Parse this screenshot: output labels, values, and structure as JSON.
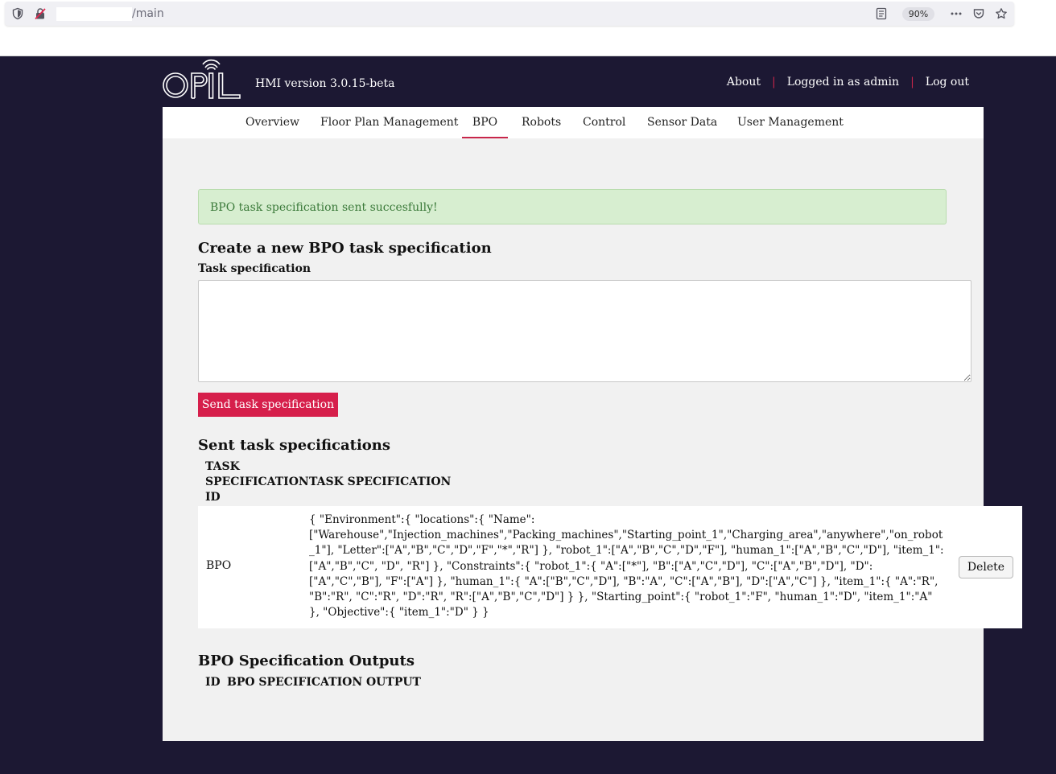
{
  "browser": {
    "url_path": "/main",
    "zoom": "90%"
  },
  "header": {
    "hmi_version": "HMI version 3.0.15-beta",
    "links": {
      "about": "About",
      "logged_in": "Logged in as admin",
      "logout": "Log out"
    },
    "accent_color": "#c8264a"
  },
  "nav": {
    "tabs": [
      {
        "label": "Overview"
      },
      {
        "label": "Floor Plan Management"
      },
      {
        "label": "BPO"
      },
      {
        "label": "Robots"
      },
      {
        "label": "Control"
      },
      {
        "label": "Sensor Data"
      },
      {
        "label": "User Management"
      }
    ],
    "active": "BPO"
  },
  "alert": {
    "message": "BPO task specification sent succesfully!"
  },
  "create_section": {
    "title": "Create a new BPO task specification",
    "field_label": "Task specification",
    "textarea_value": "",
    "send_button": "Send task specification"
  },
  "sent_section": {
    "title": "Sent task specifications",
    "columns": {
      "id_line1": "TASK",
      "id_line2": "SPECIFICATION",
      "id_line3": "ID",
      "spec": "TASK SPECIFICATION"
    },
    "rows": [
      {
        "id": "BPO",
        "spec": "{ \"Environment\":{ \"locations\":{ \"Name\": [\"Warehouse\",\"Injection_machines\",\"Packing_machines\",\"Starting_point_1\",\"Charging_area\",\"anywhere\",\"on_robot_1\"], \"Letter\":[\"A\",\"B\",\"C\",\"D\",\"F\",\"*\",\"R\"] }, \"robot_1\":[\"A\",\"B\",\"C\",\"D\",\"F\"], \"human_1\":[\"A\",\"B\",\"C\",\"D\"], \"item_1\": [\"A\",\"B\",\"C\", \"D\", \"R\"] }, \"Constraints\":{ \"robot_1\":{ \"A\":[\"*\"], \"B\":[\"A\",\"C\",\"D\"], \"C\":[\"A\",\"B\",\"D\"], \"D\":[\"A\",\"C\",\"B\"], \"F\":[\"A\"] }, \"human_1\":{ \"A\":[\"B\",\"C\",\"D\"], \"B\":\"A\", \"C\":[\"A\",\"B\"], \"D\":[\"A\",\"C\"] }, \"item_1\":{ \"A\":\"R\", \"B\":\"R\", \"C\":\"R\", \"D\":\"R\", \"R\":[\"A\",\"B\",\"C\",\"D\"] } }, \"Starting_point\":{ \"robot_1\":\"F\", \"human_1\":\"D\", \"item_1\":\"A\" }, \"Objective\":{ \"item_1\":\"D\" } }",
        "delete_label": "Delete"
      }
    ]
  },
  "outputs_section": {
    "title": "BPO Specification Outputs",
    "columns": {
      "id": "ID",
      "output": "BPO SPECIFICATION OUTPUT"
    }
  }
}
